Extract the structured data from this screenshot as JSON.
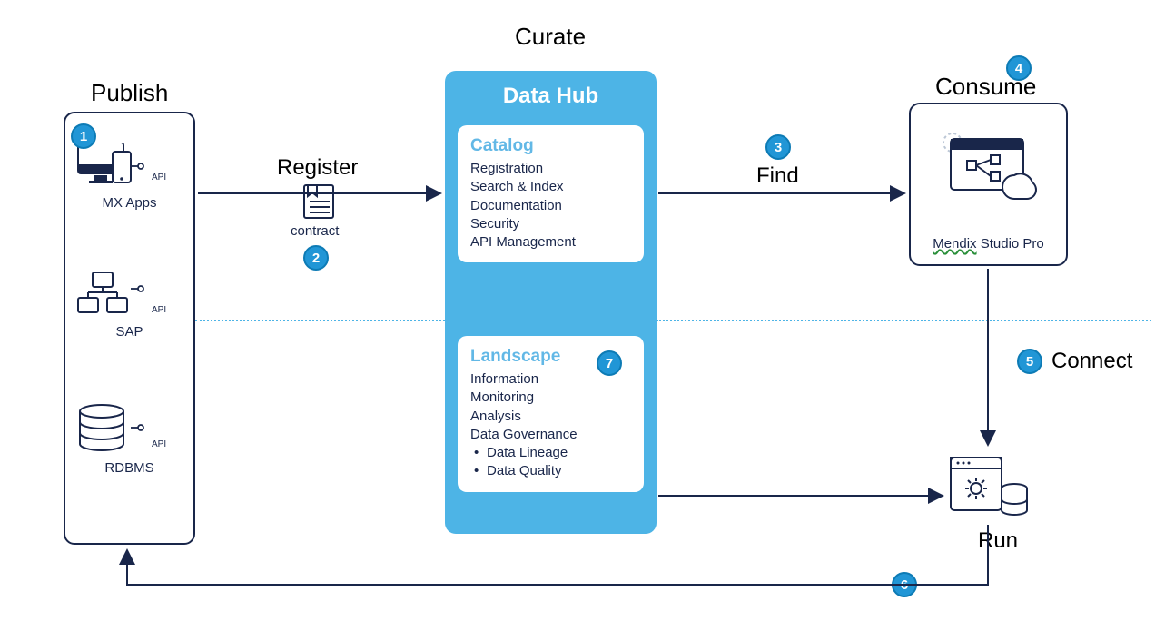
{
  "diagram": {
    "sections": {
      "publish": "Publish",
      "curate": "Curate",
      "consume": "Consume",
      "register": "Register",
      "find": "Find",
      "connect": "Connect",
      "run": "Run"
    },
    "publish_items": [
      {
        "label": "MX Apps",
        "api": "API"
      },
      {
        "label": "SAP",
        "api": "API"
      },
      {
        "label": "RDBMS",
        "api": "API"
      }
    ],
    "register_caption": "contract",
    "datahub": {
      "title": "Data Hub",
      "catalog": {
        "title": "Catalog",
        "items": [
          "Registration",
          "Search & Index",
          "Documentation",
          "Security",
          "API Management"
        ]
      },
      "landscape": {
        "title": "Landscape",
        "items": [
          "Information",
          "Monitoring",
          "Analysis",
          "Data Governance"
        ],
        "bullets": [
          "Data Lineage",
          "Data Quality"
        ]
      }
    },
    "consume_caption_highlight": "Mendix",
    "consume_caption_rest": " Studio Pro",
    "badges": {
      "b1": "1",
      "b2": "2",
      "b3": "3",
      "b4": "4",
      "b5": "5",
      "b6": "6",
      "b7": "7"
    }
  }
}
